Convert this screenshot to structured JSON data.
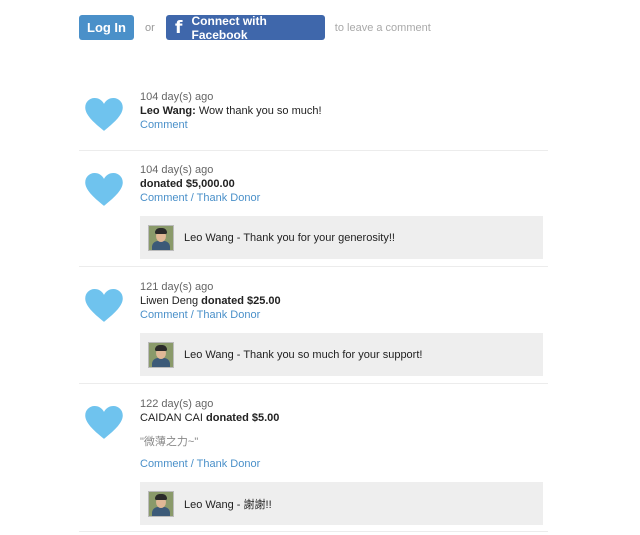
{
  "auth": {
    "login_label": "Log In",
    "or_label": "or",
    "facebook_label": "Connect with Facebook",
    "leave_label": "to leave a comment"
  },
  "colors": {
    "heart": "#6fc3ee",
    "link": "#4a90c9",
    "facebook": "#3f67ab",
    "login": "#4a90c9"
  },
  "entries": [
    {
      "time": "104 day(s) ago",
      "author": "Leo Wang:",
      "text": "Wow thank you so much!",
      "actions": {
        "comment": "Comment"
      }
    },
    {
      "time": "104 day(s) ago",
      "donation": "donated $5,000.00",
      "actions": {
        "comment": "Comment",
        "sep": " / ",
        "thank": "Thank Donor"
      },
      "reply": "Leo Wang - Thank you for your generosity!!"
    },
    {
      "time": "121 day(s) ago",
      "donor": "Liwen Deng",
      "donation": "donated $25.00",
      "actions": {
        "comment": "Comment",
        "sep": " / ",
        "thank": "Thank Donor"
      },
      "reply": "Leo Wang - Thank you so much for your support!"
    },
    {
      "time": "122 day(s) ago",
      "donor": "CAIDAN CAI",
      "donation": "donated $5.00",
      "quote": "\"微薄之力~\"",
      "actions": {
        "comment": "Comment",
        "sep": " / ",
        "thank": "Thank Donor"
      },
      "reply": "Leo Wang - 謝謝!!"
    }
  ]
}
